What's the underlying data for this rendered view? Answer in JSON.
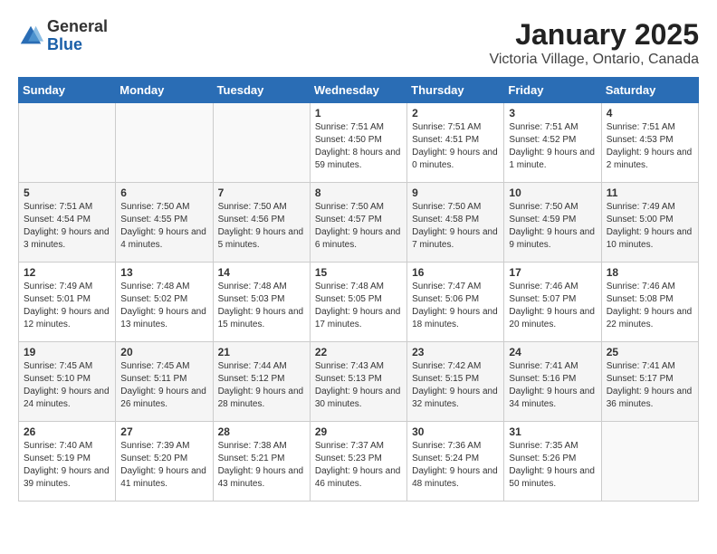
{
  "logo": {
    "text_general": "General",
    "text_blue": "Blue"
  },
  "title": "January 2025",
  "subtitle": "Victoria Village, Ontario, Canada",
  "days_of_week": [
    "Sunday",
    "Monday",
    "Tuesday",
    "Wednesday",
    "Thursday",
    "Friday",
    "Saturday"
  ],
  "weeks": [
    [
      {
        "day": "",
        "info": ""
      },
      {
        "day": "",
        "info": ""
      },
      {
        "day": "",
        "info": ""
      },
      {
        "day": "1",
        "info": "Sunrise: 7:51 AM\nSunset: 4:50 PM\nDaylight: 8 hours and 59 minutes."
      },
      {
        "day": "2",
        "info": "Sunrise: 7:51 AM\nSunset: 4:51 PM\nDaylight: 9 hours and 0 minutes."
      },
      {
        "day": "3",
        "info": "Sunrise: 7:51 AM\nSunset: 4:52 PM\nDaylight: 9 hours and 1 minute."
      },
      {
        "day": "4",
        "info": "Sunrise: 7:51 AM\nSunset: 4:53 PM\nDaylight: 9 hours and 2 minutes."
      }
    ],
    [
      {
        "day": "5",
        "info": "Sunrise: 7:51 AM\nSunset: 4:54 PM\nDaylight: 9 hours and 3 minutes."
      },
      {
        "day": "6",
        "info": "Sunrise: 7:50 AM\nSunset: 4:55 PM\nDaylight: 9 hours and 4 minutes."
      },
      {
        "day": "7",
        "info": "Sunrise: 7:50 AM\nSunset: 4:56 PM\nDaylight: 9 hours and 5 minutes."
      },
      {
        "day": "8",
        "info": "Sunrise: 7:50 AM\nSunset: 4:57 PM\nDaylight: 9 hours and 6 minutes."
      },
      {
        "day": "9",
        "info": "Sunrise: 7:50 AM\nSunset: 4:58 PM\nDaylight: 9 hours and 7 minutes."
      },
      {
        "day": "10",
        "info": "Sunrise: 7:50 AM\nSunset: 4:59 PM\nDaylight: 9 hours and 9 minutes."
      },
      {
        "day": "11",
        "info": "Sunrise: 7:49 AM\nSunset: 5:00 PM\nDaylight: 9 hours and 10 minutes."
      }
    ],
    [
      {
        "day": "12",
        "info": "Sunrise: 7:49 AM\nSunset: 5:01 PM\nDaylight: 9 hours and 12 minutes."
      },
      {
        "day": "13",
        "info": "Sunrise: 7:48 AM\nSunset: 5:02 PM\nDaylight: 9 hours and 13 minutes."
      },
      {
        "day": "14",
        "info": "Sunrise: 7:48 AM\nSunset: 5:03 PM\nDaylight: 9 hours and 15 minutes."
      },
      {
        "day": "15",
        "info": "Sunrise: 7:48 AM\nSunset: 5:05 PM\nDaylight: 9 hours and 17 minutes."
      },
      {
        "day": "16",
        "info": "Sunrise: 7:47 AM\nSunset: 5:06 PM\nDaylight: 9 hours and 18 minutes."
      },
      {
        "day": "17",
        "info": "Sunrise: 7:46 AM\nSunset: 5:07 PM\nDaylight: 9 hours and 20 minutes."
      },
      {
        "day": "18",
        "info": "Sunrise: 7:46 AM\nSunset: 5:08 PM\nDaylight: 9 hours and 22 minutes."
      }
    ],
    [
      {
        "day": "19",
        "info": "Sunrise: 7:45 AM\nSunset: 5:10 PM\nDaylight: 9 hours and 24 minutes."
      },
      {
        "day": "20",
        "info": "Sunrise: 7:45 AM\nSunset: 5:11 PM\nDaylight: 9 hours and 26 minutes."
      },
      {
        "day": "21",
        "info": "Sunrise: 7:44 AM\nSunset: 5:12 PM\nDaylight: 9 hours and 28 minutes."
      },
      {
        "day": "22",
        "info": "Sunrise: 7:43 AM\nSunset: 5:13 PM\nDaylight: 9 hours and 30 minutes."
      },
      {
        "day": "23",
        "info": "Sunrise: 7:42 AM\nSunset: 5:15 PM\nDaylight: 9 hours and 32 minutes."
      },
      {
        "day": "24",
        "info": "Sunrise: 7:41 AM\nSunset: 5:16 PM\nDaylight: 9 hours and 34 minutes."
      },
      {
        "day": "25",
        "info": "Sunrise: 7:41 AM\nSunset: 5:17 PM\nDaylight: 9 hours and 36 minutes."
      }
    ],
    [
      {
        "day": "26",
        "info": "Sunrise: 7:40 AM\nSunset: 5:19 PM\nDaylight: 9 hours and 39 minutes."
      },
      {
        "day": "27",
        "info": "Sunrise: 7:39 AM\nSunset: 5:20 PM\nDaylight: 9 hours and 41 minutes."
      },
      {
        "day": "28",
        "info": "Sunrise: 7:38 AM\nSunset: 5:21 PM\nDaylight: 9 hours and 43 minutes."
      },
      {
        "day": "29",
        "info": "Sunrise: 7:37 AM\nSunset: 5:23 PM\nDaylight: 9 hours and 46 minutes."
      },
      {
        "day": "30",
        "info": "Sunrise: 7:36 AM\nSunset: 5:24 PM\nDaylight: 9 hours and 48 minutes."
      },
      {
        "day": "31",
        "info": "Sunrise: 7:35 AM\nSunset: 5:26 PM\nDaylight: 9 hours and 50 minutes."
      },
      {
        "day": "",
        "info": ""
      }
    ]
  ]
}
